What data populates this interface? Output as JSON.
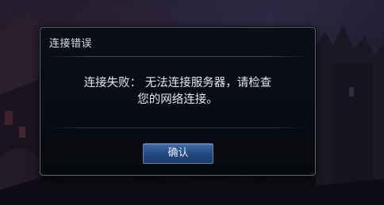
{
  "dialog": {
    "title": "连接错误",
    "message_line1": "连接失败： 无法连接服务器，请检查",
    "message_line2": "您的网络连接。",
    "confirm_label": "确认"
  },
  "colors": {
    "dialog_border": "#5a6170",
    "dialog_background": "#07090f",
    "button_blue": "#244a80",
    "text": "#e4e7ee"
  }
}
